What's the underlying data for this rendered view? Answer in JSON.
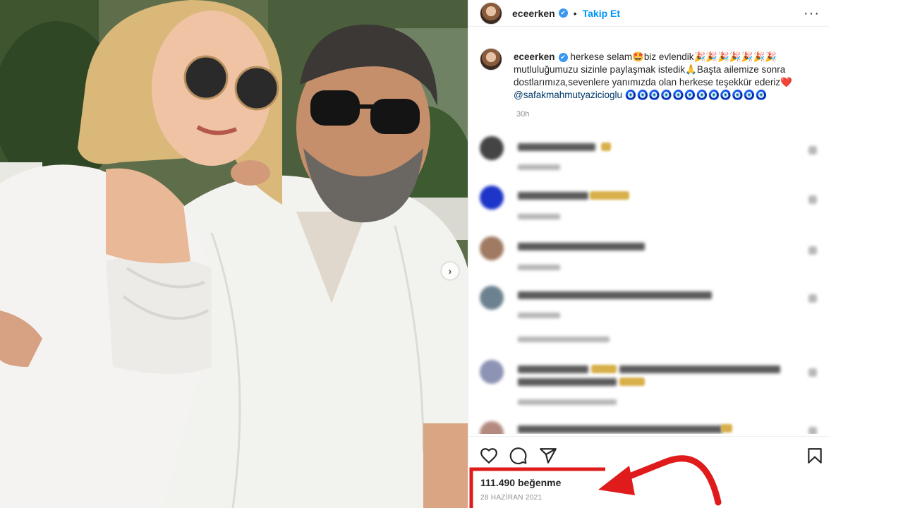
{
  "post": {
    "username": "eceerken",
    "verified_mark": "✔",
    "separator": "•",
    "follow_label": "Takip Et",
    "more_label": "···",
    "caption_username": "eceerken",
    "caption_text_1": "herkese selam🤩biz evlendik🎉🎉🎉🎉🎉🎉🎉",
    "caption_text_2": "mutluluğumuzu sizinle paylaşmak istedik🙏Başta ailemize sonra dostlarımıza,sevenlere yanımızda olan herkese teşekkür ederiz❤️",
    "caption_mention": "@safakmahmutyazicioglu",
    "caption_text_3": " 🧿🧿🧿🧿🧿🧿🧿🧿🧿🧿🧿🧿",
    "time_ago": "30h",
    "carousel_next": "›",
    "likes": "111.490 beğenme",
    "date": "28 HAZİRAN 2021"
  },
  "icons": {
    "like": "heart-icon",
    "comment": "comment-icon",
    "share": "share-icon",
    "save": "bookmark-icon"
  },
  "colors": {
    "link": "#0095f6",
    "verified": "#3897f0",
    "annotation": "#e01b1b"
  }
}
